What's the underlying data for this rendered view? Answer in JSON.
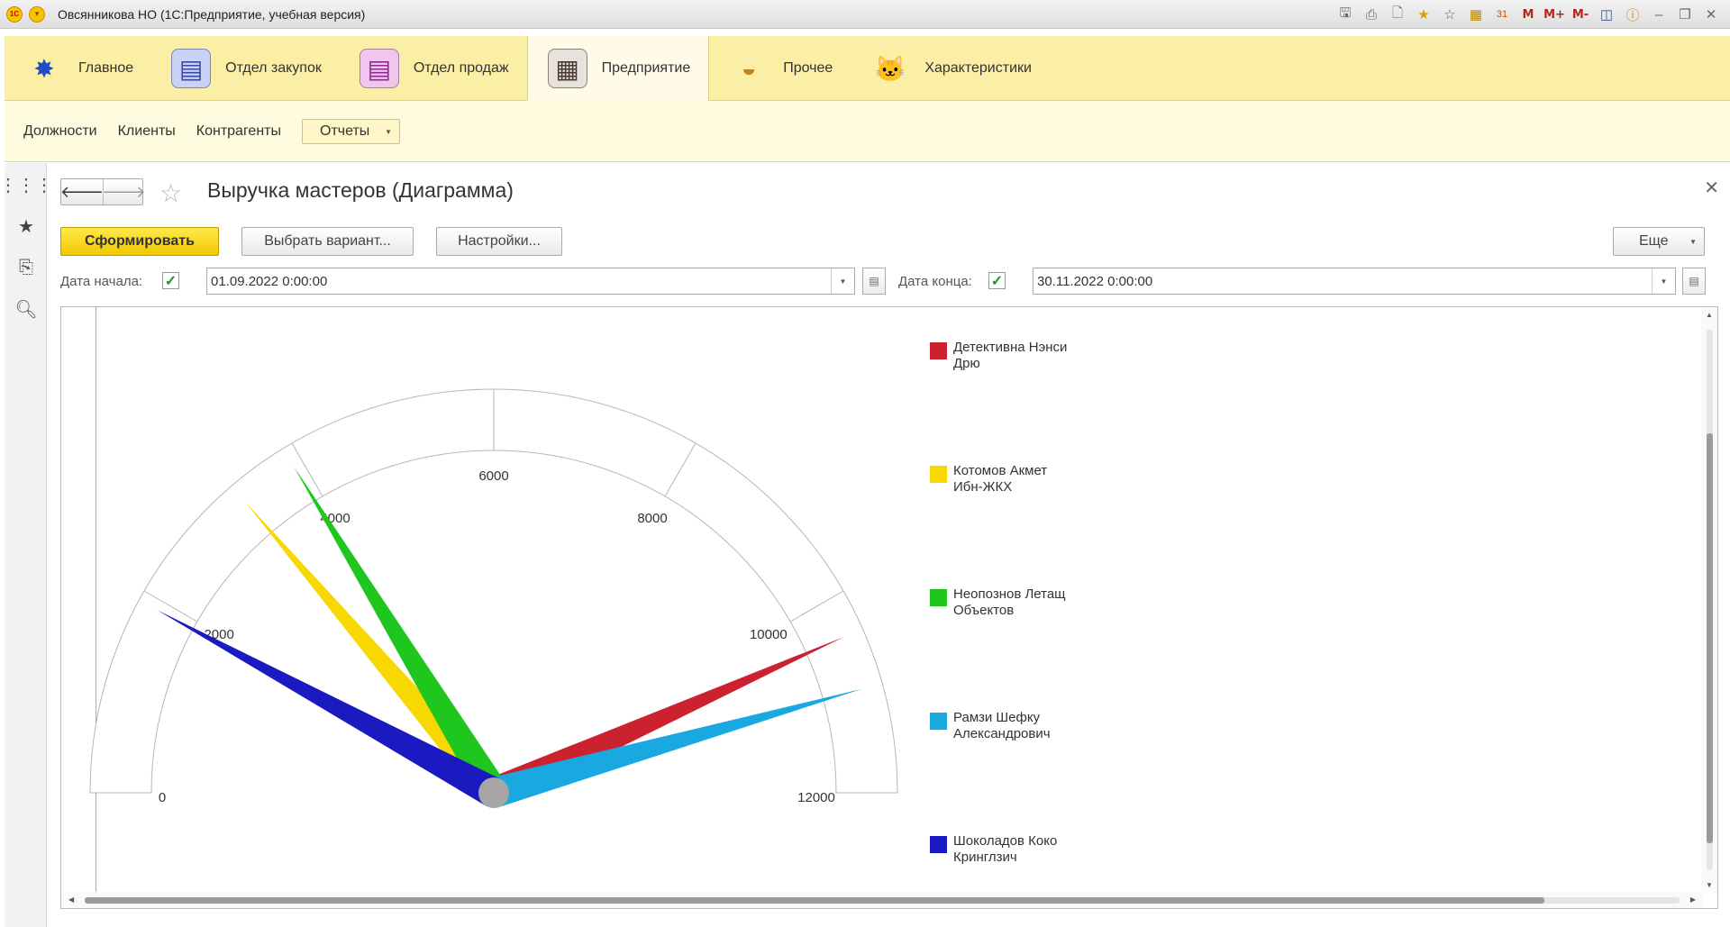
{
  "window": {
    "title": "Овсянникова НО  (1С:Предприятие, учебная версия)",
    "logo_text": "1С",
    "toolbar_icons": [
      "save-icon",
      "print-icon",
      "preview-icon",
      "favorite-add-icon",
      "favorites-icon",
      "calculator-icon",
      "calendar-icon",
      "memory-m-icon",
      "memory-plus-icon",
      "memory-minus-icon",
      "panels-icon",
      "info-icon",
      "minimize-icon",
      "restore-icon",
      "close-window-icon"
    ],
    "memory_labels": [
      "M",
      "M+",
      "M-"
    ],
    "calendar_day": "31"
  },
  "sections": [
    {
      "label": "Главное",
      "icon": "main-section-icon",
      "active": false
    },
    {
      "label": "Отдел закупок",
      "icon": "purchases-section-icon",
      "active": false
    },
    {
      "label": "Отдел продаж",
      "icon": "sales-section-icon",
      "active": false
    },
    {
      "label": "Предприятие",
      "icon": "enterprise-section-icon",
      "active": true
    },
    {
      "label": "Прочее",
      "icon": "other-section-icon",
      "active": false
    },
    {
      "label": "Характеристики",
      "icon": "characteristics-section-icon",
      "active": false
    }
  ],
  "subnav": {
    "links": [
      "Должности",
      "Клиенты",
      "Контрагенты"
    ],
    "reports_label": "Отчеты"
  },
  "left_panel": [
    "apps-grid-icon",
    "favorites-star-icon",
    "history-icon",
    "search-icon"
  ],
  "report": {
    "title": "Выручка мастеров (Диаграмма)",
    "generate_label": "Сформировать",
    "variant_label": "Выбрать вариант...",
    "settings_label": "Настройки...",
    "more_label": "Еще",
    "start_label": "Дата начала:",
    "start_value": "01.09.2022  0:00:00",
    "start_checked": true,
    "end_label": "Дата конца:",
    "end_value": "30.11.2022  0:00:00",
    "end_checked": true
  },
  "chart_data": {
    "type": "gauge",
    "scale_min": 0,
    "scale_max": 12000,
    "ticks": [
      0,
      2000,
      4000,
      6000,
      8000,
      10000,
      12000
    ],
    "tick_labels": [
      "0",
      "2000",
      "4000",
      "6000",
      "8000",
      "10000",
      "12000"
    ],
    "legend_position": "right",
    "series": [
      {
        "name": "Детективна Нэнси\nДрю",
        "value": 10400,
        "color": "#cc2230"
      },
      {
        "name": "Котомов Акмет\nИбн-ЖКХ",
        "value": 3300,
        "color": "#f7d800"
      },
      {
        "name": "Неопознов Летащ\nОбъектов",
        "value": 3900,
        "color": "#1ec61e"
      },
      {
        "name": "Рамзи Шефку\nАлександрович",
        "value": 10950,
        "color": "#1aa8e0"
      },
      {
        "name": "Шоколадов Коко\nКринглзич",
        "value": 1900,
        "color": "#1a1ac0"
      }
    ]
  }
}
